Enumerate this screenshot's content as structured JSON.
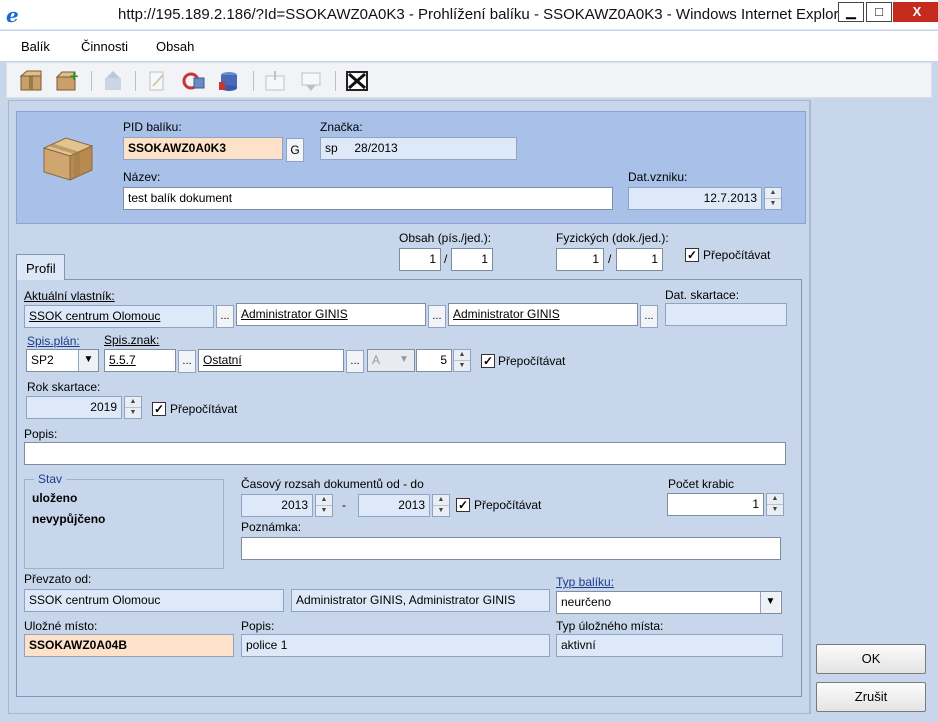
{
  "window": {
    "title": "http://195.189.2.186/?Id=SSOKAWZ0A0K3 - Prohlížení balíku - SSOKAWZ0A0K3 - Windows Internet Explorer",
    "min": "▁",
    "max": "□",
    "close": "X"
  },
  "menu": [
    "Balík",
    "Činnosti",
    "Obsah"
  ],
  "toolbar": {
    "icons": [
      "package-icon",
      "new-package-icon",
      "send-icon",
      "edit-icon",
      "refresh-icon",
      "database-icon",
      "insert-icon",
      "remove-icon",
      "delete-icon"
    ]
  },
  "header": {
    "pid_label": "PID balíku:",
    "pid_value": "SSOKAWZ0A0K3",
    "g_button": "G",
    "znacka_label": "Značka:",
    "znacka_value": "sp     28/2013",
    "nazev_label": "Název:",
    "nazev_value": "test balík dokument",
    "datvzniku_label": "Dat.vzniku:",
    "datvzniku_value": "12.7.2013"
  },
  "counts": {
    "obsah_label": "Obsah (pís./jed.):",
    "obsah_a": "1",
    "obsah_b": "1",
    "fyz_label": "Fyzických (dok./jed.):",
    "fyz_a": "1",
    "fyz_b": "1",
    "slash": "/",
    "prepocitavat": "Přepočítávat"
  },
  "tab": {
    "label": "Profil"
  },
  "profil": {
    "vlastnik_label": "Aktuální vlastník:",
    "vlastnik_1": "SSOK  centrum Olomouc",
    "vlastnik_2": "Administrator GINIS",
    "vlastnik_3": "Administrator GINIS",
    "dots": "...",
    "datskartace_label": "Dat. skartace:",
    "datskartace_value": "",
    "spisplan_label": "Spis.plán:",
    "spisplan_value": "SP2",
    "spisznak_label": "Spis.znak:",
    "spisznak_value": "5.5.7",
    "spisznak_text": "Ostatní",
    "skartznak": "A",
    "skartlhuta": "5",
    "prepocitavat": "Přepočítávat",
    "rok_label": "Rok skartace:",
    "rok_value": "2019",
    "popis_label": "Popis:",
    "popis_value": "",
    "stav_label": "Stav",
    "stav_1": "uloženo",
    "stav_2": "nevypůjčeno",
    "casovy_label": "Časový rozsah dokumentů od - do",
    "od": "2013",
    "dash": "-",
    "do": "2013",
    "pocetkrabic_label": "Počet krabic",
    "pocetkrabic_value": "1",
    "poznamka_label": "Poznámka:",
    "poznamka_value": "",
    "prevzato_label": "Převzato od:",
    "prevzato_1": "SSOK  centrum Olomouc",
    "prevzato_2": "Administrator GINIS, Administrator GINIS",
    "typbaliku_label": "Typ balíku:",
    "typbaliku_value": "neurčeno",
    "ulozne_label": "Uložné místo:",
    "ulozne_value": "SSOKAWZ0A04B",
    "popis2_label": "Popis:",
    "popis2_value": "police 1",
    "typulozne_label": "Typ úložného místa:",
    "typulozne_value": "aktivní"
  },
  "buttons": {
    "ok": "OK",
    "cancel": "Zrušit"
  }
}
